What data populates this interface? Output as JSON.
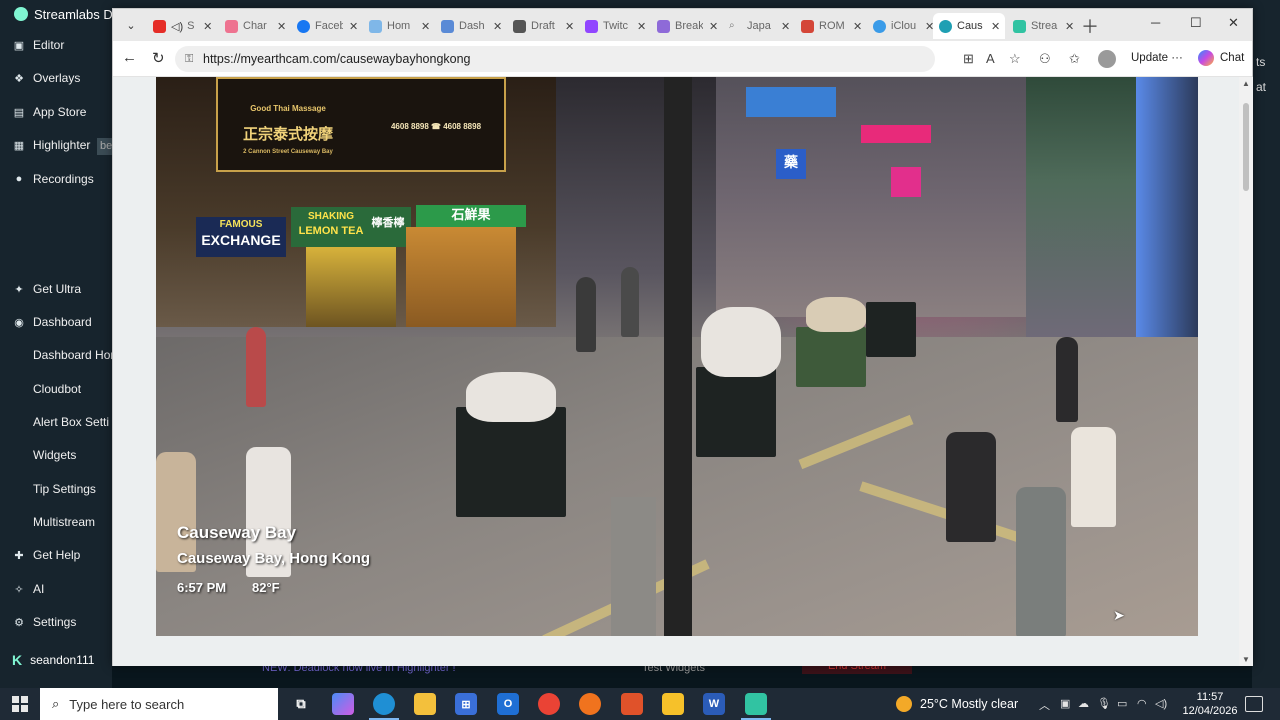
{
  "streamlabs": {
    "title": "Streamlabs De",
    "nav": [
      {
        "label": "Editor",
        "icon": "editor-icon"
      },
      {
        "label": "Overlays",
        "icon": "overlays-icon"
      },
      {
        "label": "App Store",
        "icon": "app-store-icon"
      },
      {
        "label": "Highlighter",
        "icon": "highlighter-icon"
      },
      {
        "label": "Recordings",
        "icon": "recordings-icon"
      },
      {
        "label": "Get Ultra",
        "icon": "ultra-icon"
      },
      {
        "label": "Dashboard",
        "icon": "dashboard-icon"
      },
      {
        "label": "Dashboard Hom",
        "icon": ""
      },
      {
        "label": "Cloudbot",
        "icon": ""
      },
      {
        "label": "Alert Box Setti",
        "icon": ""
      },
      {
        "label": "Widgets",
        "icon": ""
      },
      {
        "label": "Tip Settings",
        "icon": ""
      },
      {
        "label": "Multistream",
        "icon": ""
      },
      {
        "label": "Get Help",
        "icon": "help-icon"
      },
      {
        "label": "AI",
        "icon": "ai-icon"
      },
      {
        "label": "Settings",
        "icon": "settings-icon"
      }
    ],
    "highlighter_badge": "be",
    "username": "seandon111",
    "user_initial": "K",
    "right_labels": [
      "ts",
      "at"
    ],
    "bottom": {
      "news": "NEW: Deadlock now live in Highlighter !",
      "test_widgets": "Test Widgets",
      "end_stream": "End Stream"
    }
  },
  "browser": {
    "tabs": [
      {
        "label": "S",
        "color": "#e52d27"
      },
      {
        "label": "Char",
        "color": "#ee7390"
      },
      {
        "label": "Faceb",
        "color": "#1877f2"
      },
      {
        "label": "Hom",
        "color": "#7fb7e8"
      },
      {
        "label": "Dash",
        "color": "#5a8ad6"
      },
      {
        "label": "Draft",
        "color": "#555555"
      },
      {
        "label": "Twitc",
        "color": "#9146ff"
      },
      {
        "label": "Break",
        "color": "#8e6ad8"
      },
      {
        "label": "Japa",
        "color": "#777777"
      },
      {
        "label": "ROM",
        "color": "#d44638"
      },
      {
        "label": "iClou",
        "color": "#3a9be8"
      },
      {
        "label": "Caus",
        "color": "#1f9fb3"
      },
      {
        "label": "Strea",
        "color": "#31c3a2"
      }
    ],
    "active_tab": "Caus",
    "url": "https://myearthcam.com/causewaybayhongkong",
    "update_label": "Update",
    "chat_label": "Chat"
  },
  "video": {
    "location_title": "Causeway Bay",
    "location_subtitle": "Causeway Bay, Hong Kong",
    "time": "6:57 PM",
    "temperature": "82°F",
    "signs": {
      "thai_line1": "Good Thai Massage",
      "thai_line2": "正宗泰式按摩",
      "thai_line3": "2 Cannon Street Causeway Bay",
      "thai_phone": "4608 8898 ☎ 4608 8898",
      "exchange_top": "FAMOUS",
      "exchange": "EXCHANGE",
      "lemon_top": "SHAKING",
      "lemon": "LEMON TEA",
      "lemon_cn": "檸香檸",
      "shop_cn": "石鮮果",
      "pharmacy": "藥"
    }
  },
  "taskbar": {
    "search_placeholder": "Type here to search",
    "weather_temp": "25°C",
    "weather_text": "Mostly clear",
    "time": "11:57",
    "date": "12/04/2026"
  }
}
